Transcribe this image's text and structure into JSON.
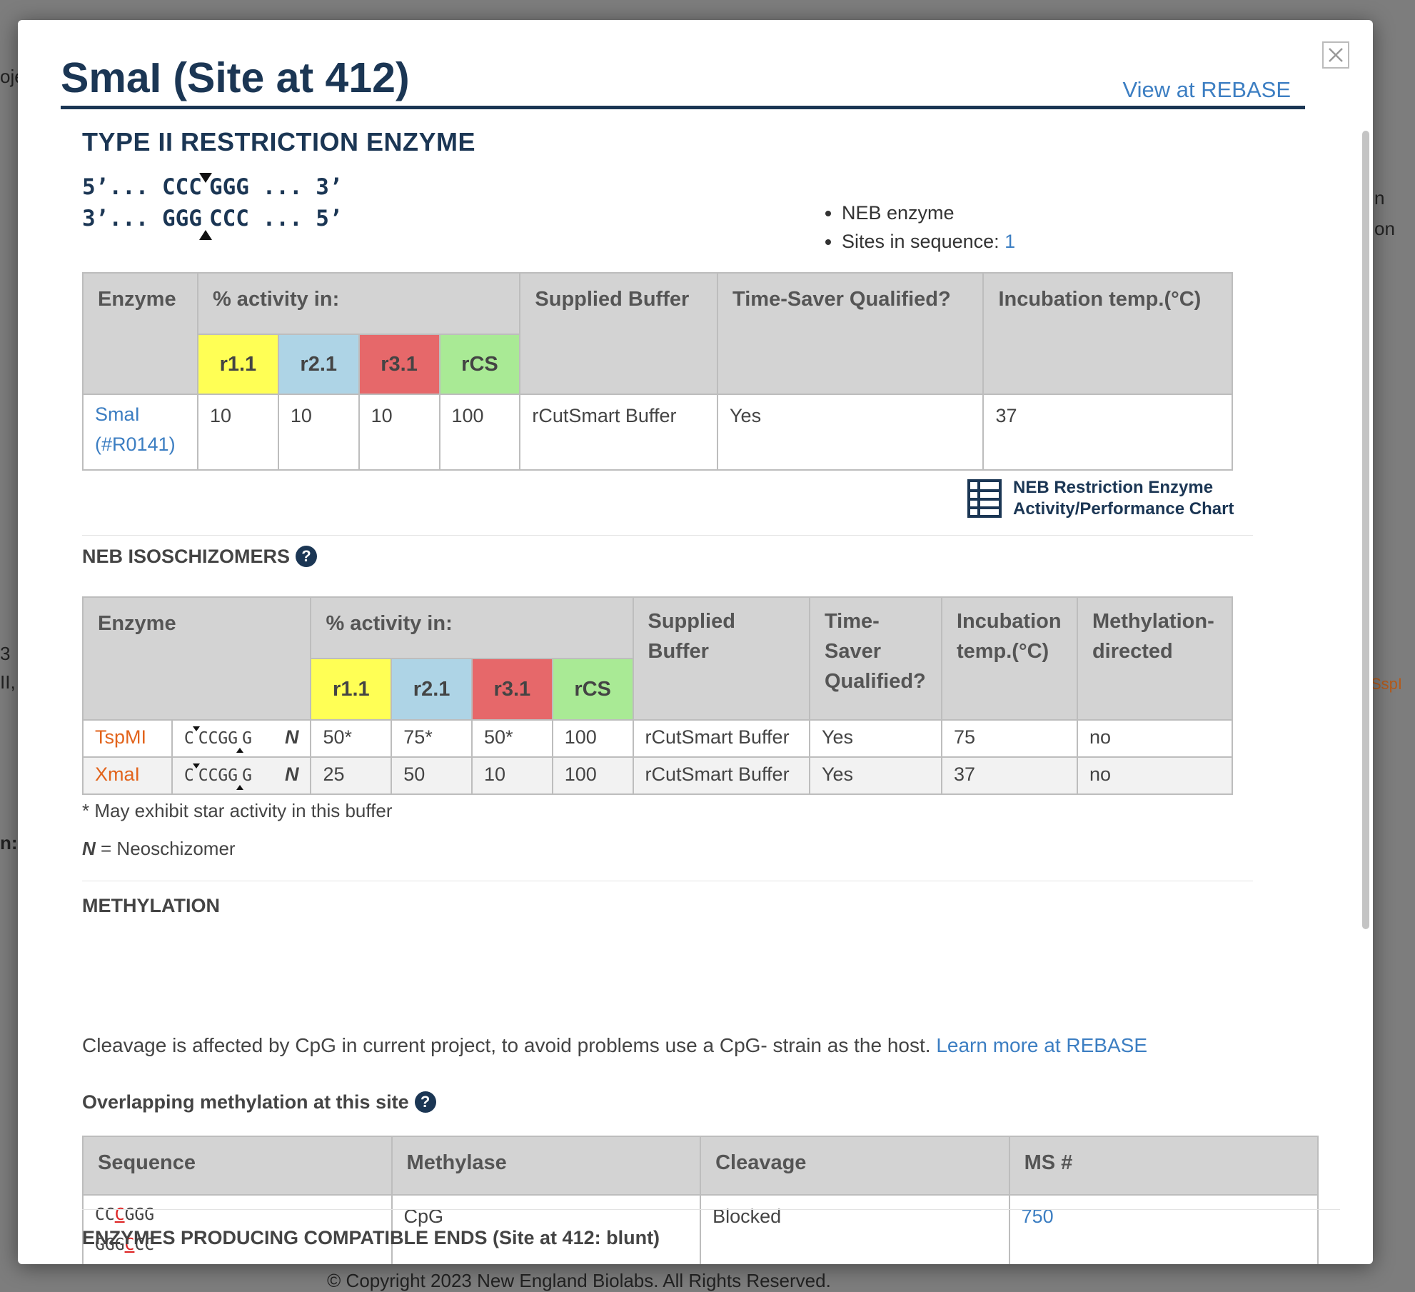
{
  "background": {
    "footer": "© Copyright 2023 New England Biolabs. All Rights Reserved.",
    "left_fragments": [
      "oje",
      "3",
      "II,",
      "n:"
    ],
    "right_fragments": [
      "n",
      "on",
      "SspI"
    ]
  },
  "modal": {
    "title": "SmaI (Site at 412)",
    "rebase_link": "View at REBASE",
    "close_icon": "close-icon"
  },
  "enzyme": {
    "type_heading": "TYPE II RESTRICTION ENZYME",
    "seq_top_left": "5’... CCC",
    "seq_top_right": "GGG ... 3’",
    "seq_bottom_left": "3’... GGG",
    "seq_bottom_right": "CCC ... 5’",
    "bullet_neb": "NEB enzyme",
    "bullet_sites_label": "Sites in sequence: ",
    "bullet_sites_value": "1"
  },
  "main_table": {
    "headers": {
      "enzyme": "Enzyme",
      "activity": "% activity in:",
      "buffer": "Supplied Buffer",
      "timesaver": "Time-Saver Qualified?",
      "temp": "Incubation temp.(°C)"
    },
    "buffers": [
      "r1.1",
      "r2.1",
      "r3.1",
      "rCS"
    ],
    "row": {
      "enzyme_name": "SmaI",
      "enzyme_cat": "(#R0141)",
      "r11": "10",
      "r21": "10",
      "r31": "10",
      "rcs": "100",
      "buffer": "rCutSmart Buffer",
      "timesaver": "Yes",
      "temp": "37"
    }
  },
  "chart_link": {
    "line1": "NEB Restriction Enzyme",
    "line2": "Activity/Performance Chart"
  },
  "isoschizomers": {
    "title": "NEB ISOSCHIZOMERS",
    "headers": {
      "enzyme": "Enzyme",
      "activity": "% activity in:",
      "buffer_l1": "Supplied",
      "buffer_l2": "Buffer",
      "ts_l1": "Time-",
      "ts_l2": "Saver",
      "ts_l3": "Qualified?",
      "temp_l1": "Incubation",
      "temp_l2": "temp.(°C)",
      "meth_l1": "Methylation-",
      "meth_l2": "directed"
    },
    "rows": [
      {
        "name": "TspMI",
        "site_a": "C",
        "site_b": "CCGG",
        "site_c": "G",
        "type": "N",
        "r11": "50*",
        "r21": "75*",
        "r31": "50*",
        "rcs": "100",
        "buffer": "rCutSmart Buffer",
        "timesaver": "Yes",
        "temp": "75",
        "meth": "no"
      },
      {
        "name": "XmaI",
        "site_a": "C",
        "site_b": "CCGG",
        "site_c": "G",
        "type": "N",
        "r11": "25",
        "r21": "50",
        "r31": "10",
        "rcs": "100",
        "buffer": "rCutSmart Buffer",
        "timesaver": "Yes",
        "temp": "37",
        "meth": "no"
      }
    ],
    "star_note": "* May exhibit star activity in this buffer",
    "neo_symbol": "N",
    "neo_note": " = Neoschizomer"
  },
  "methylation": {
    "title": "METHYLATION",
    "text": "Cleavage is affected by CpG in current project, to avoid problems use a CpG- strain as the host. ",
    "link": "Learn more at REBASE",
    "overlap_title": "Overlapping methylation at this site",
    "headers": {
      "sequence": "Sequence",
      "methylase": "Methylase",
      "cleavage": "Cleavage",
      "ms": "MS #"
    },
    "row": {
      "seq1_a": "CC",
      "seq1_b": "C",
      "seq1_c": "GGG",
      "seq2_a": "GGG",
      "seq2_b": "C",
      "seq2_c": "CC",
      "methylase": "CpG",
      "cleavage": "Blocked",
      "ms": "750"
    }
  },
  "compatible": {
    "title": "ENZYMES PRODUCING COMPATIBLE ENDS (Site at 412: blunt)"
  }
}
